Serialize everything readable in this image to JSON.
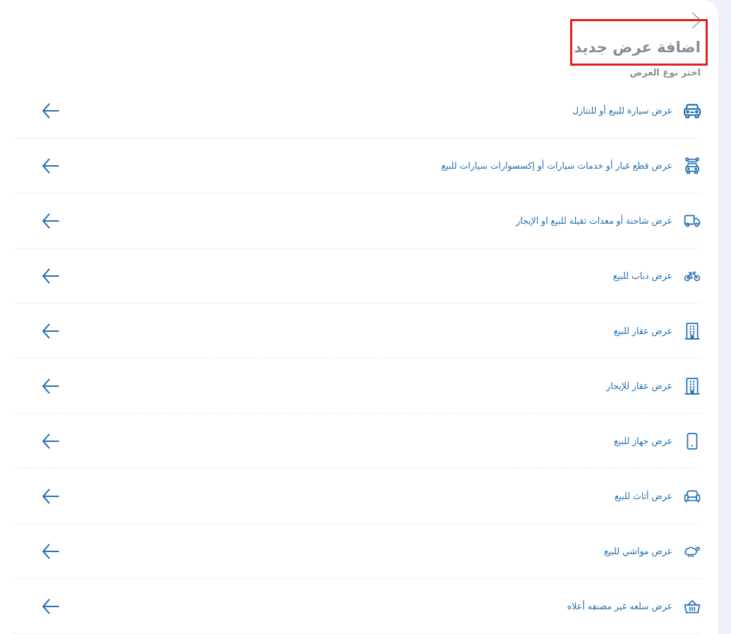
{
  "header": {
    "title": "اضافة عرض جديد",
    "subtitle": "اختر نوع العرض"
  },
  "offer_types": [
    {
      "label": "عرض سيارة للبيع أو للتنازل",
      "kind": "car"
    },
    {
      "label": "عرض قطع غيار أو خدمات سيارات أو إكسسوارات سيارات للبيع",
      "kind": "parts"
    },
    {
      "label": "عرض شاحنة أو معدات ثقيلة للبيع او الإيجار",
      "kind": "truck"
    },
    {
      "label": "عرض دباب للبيع",
      "kind": "motorcycle"
    },
    {
      "label": "عرض عقار للبيع",
      "kind": "building"
    },
    {
      "label": "عرض عقار للإيجار",
      "kind": "building"
    },
    {
      "label": "عرض جهاز للبيع",
      "kind": "phone"
    },
    {
      "label": "عرض أثاث للبيع",
      "kind": "sofa"
    },
    {
      "label": "عرض مواشي للبيع",
      "kind": "livestock"
    },
    {
      "label": "عرض سلعه غير مصنفه أعلاه",
      "kind": "basket"
    }
  ]
}
